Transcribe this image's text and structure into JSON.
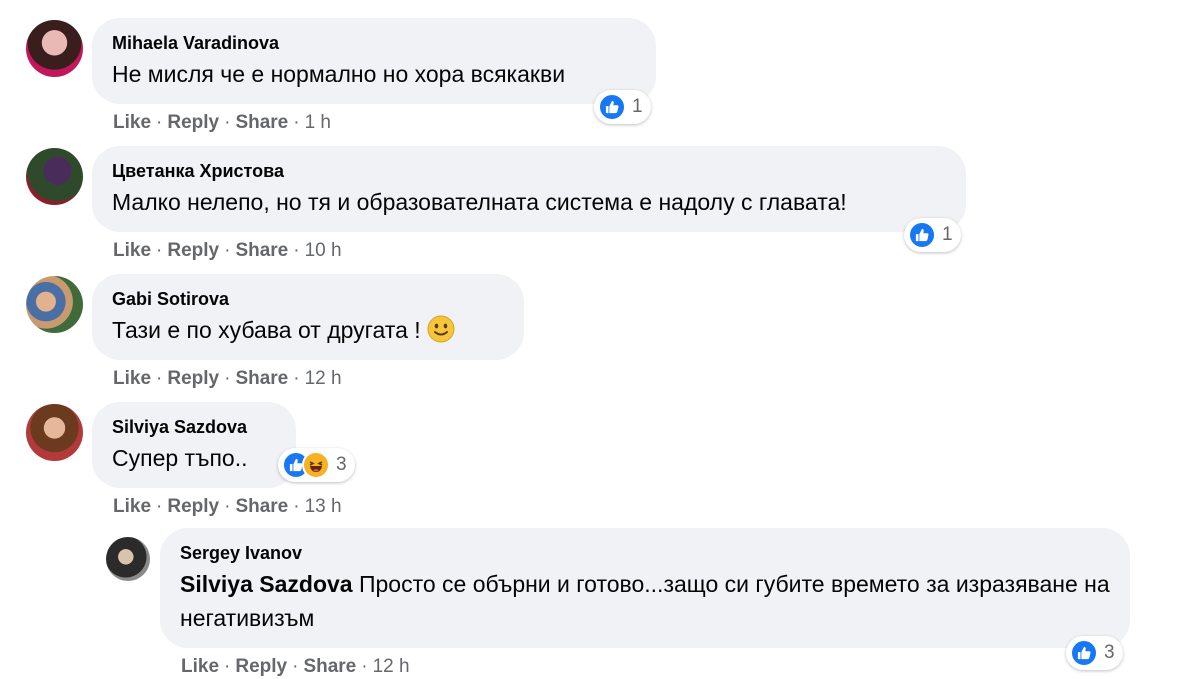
{
  "actions": {
    "like": "Like",
    "reply": "Reply",
    "share": "Share",
    "sep": "·"
  },
  "colors": {
    "bubble": "#f0f2f5",
    "meta": "#65676b",
    "like_blue": "#1877f2",
    "haha_yellow": "#f7b125"
  },
  "comments": [
    {
      "author": "Mihaela Varadinova",
      "text": "Не мисля че е нормално но хора всякакви",
      "time": "1 h",
      "reactions": [
        "like"
      ],
      "reaction_count": "1"
    },
    {
      "author": "Цветанка Христова",
      "text": "Малко нелепо, но тя и образователната система е надолу с главата!",
      "time": "10 h",
      "reactions": [
        "like"
      ],
      "reaction_count": "1"
    },
    {
      "author": "Gabi Sotirova",
      "text": "Тази е по хубава от другата !",
      "emoji": "slightly-smiling-face",
      "time": "12 h"
    },
    {
      "author": "Silviya Sazdova",
      "text": "Супер тъпо..",
      "time": "13 h",
      "reactions": [
        "like",
        "haha"
      ],
      "reaction_count": "3"
    },
    {
      "author": "Sergey Ivanov",
      "mention": "Silviya Sazdova",
      "text": " Просто се обърни и готово...защо си губите времето за изразяване на негативизъм",
      "time": "12 h",
      "reactions": [
        "like"
      ],
      "reaction_count": "3",
      "is_reply": true
    }
  ]
}
